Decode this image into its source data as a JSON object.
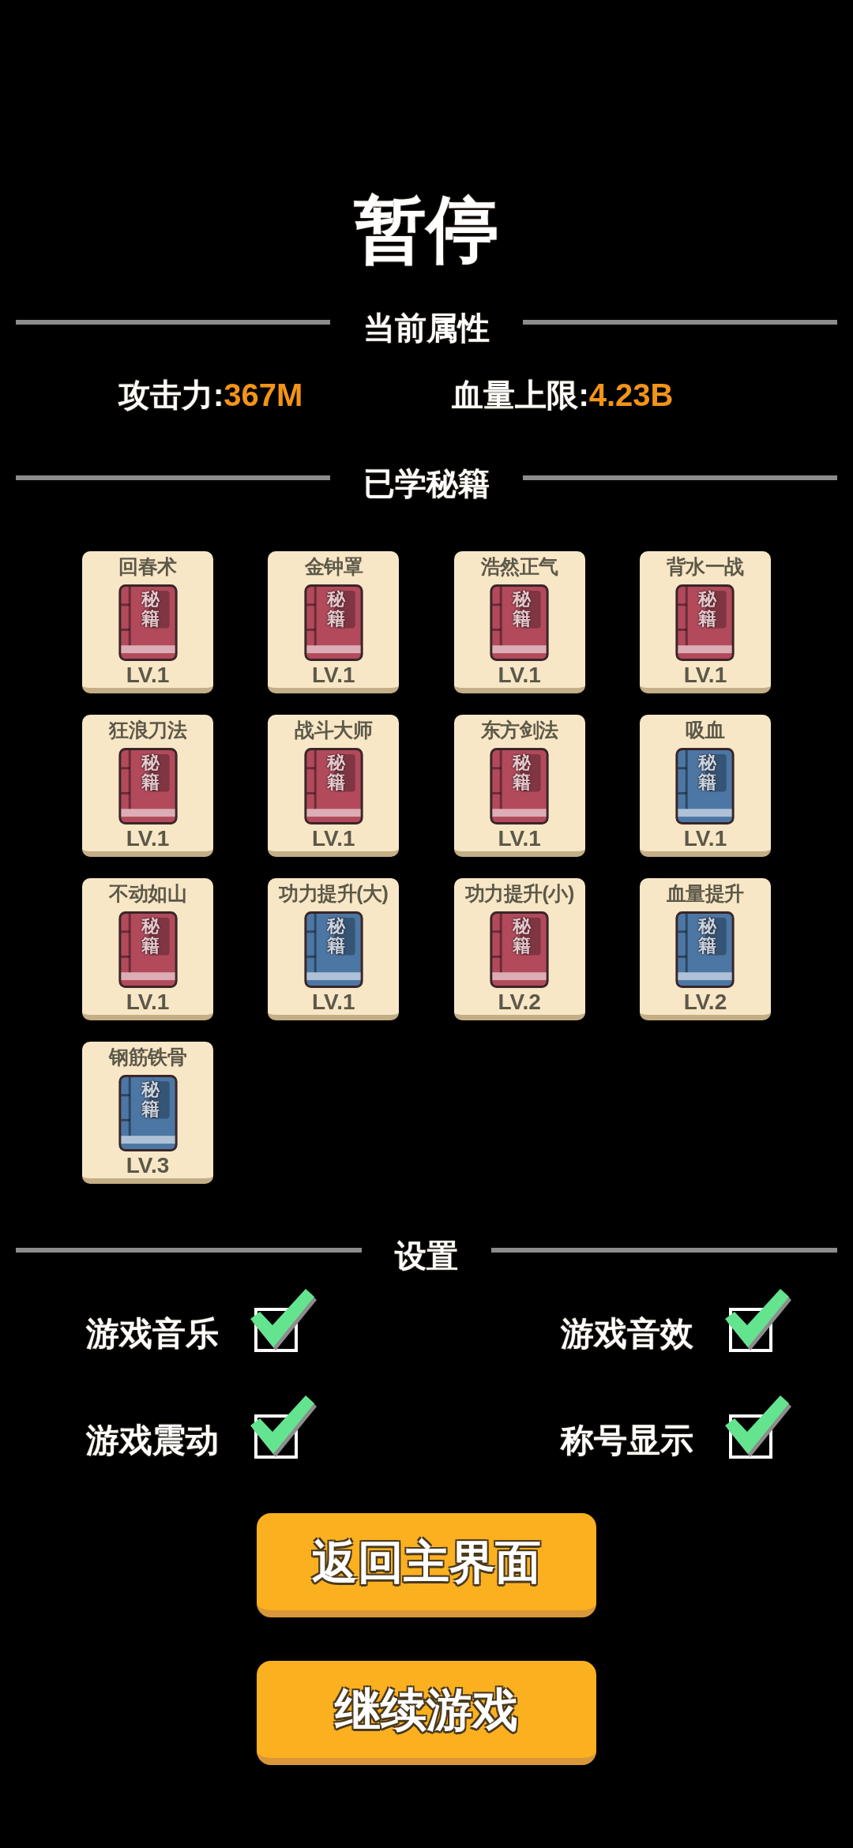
{
  "title": "暂停",
  "attributes": {
    "heading": "当前属性",
    "stats": [
      {
        "label": "攻击力:",
        "value": "367M"
      },
      {
        "label": "血量上限:",
        "value": "4.23B"
      }
    ]
  },
  "skills": {
    "heading": "已学秘籍",
    "items": [
      {
        "name": "回春术",
        "cover": "秘籍",
        "level": "LV.1",
        "color": "#b24a5c"
      },
      {
        "name": "金钟罩",
        "cover": "秘籍",
        "level": "LV.1",
        "color": "#b24a5c"
      },
      {
        "name": "浩然正气",
        "cover": "秘籍",
        "level": "LV.1",
        "color": "#b24a5c"
      },
      {
        "name": "背水一战",
        "cover": "秘籍",
        "level": "LV.1",
        "color": "#b24a5c"
      },
      {
        "name": "狂浪刀法",
        "cover": "秘籍",
        "level": "LV.1",
        "color": "#b24a5c"
      },
      {
        "name": "战斗大师",
        "cover": "秘籍",
        "level": "LV.1",
        "color": "#b24a5c"
      },
      {
        "name": "东方剑法",
        "cover": "秘籍",
        "level": "LV.1",
        "color": "#b24a5c"
      },
      {
        "name": "吸血",
        "cover": "秘籍",
        "level": "LV.1",
        "color": "#4c77a4"
      },
      {
        "name": "不动如山",
        "cover": "秘籍",
        "level": "LV.1",
        "color": "#b24a5c"
      },
      {
        "name": "功力提升(大)",
        "cover": "秘籍",
        "level": "LV.1",
        "color": "#4c77a4"
      },
      {
        "name": "功力提升(小)",
        "cover": "秘籍",
        "level": "LV.2",
        "color": "#b24a5c"
      },
      {
        "name": "血量提升",
        "cover": "秘籍",
        "level": "LV.2",
        "color": "#4c77a4"
      },
      {
        "name": "钢筋铁骨",
        "cover": "秘籍",
        "level": "LV.3",
        "color": "#4c77a4"
      }
    ]
  },
  "settings": {
    "heading": "设置",
    "options": [
      {
        "label": "游戏音乐",
        "checked": true
      },
      {
        "label": "游戏音效",
        "checked": true
      },
      {
        "label": "游戏震动",
        "checked": true
      },
      {
        "label": "称号显示",
        "checked": true
      }
    ]
  },
  "buttons": [
    "返回主界面",
    "继续游戏"
  ]
}
